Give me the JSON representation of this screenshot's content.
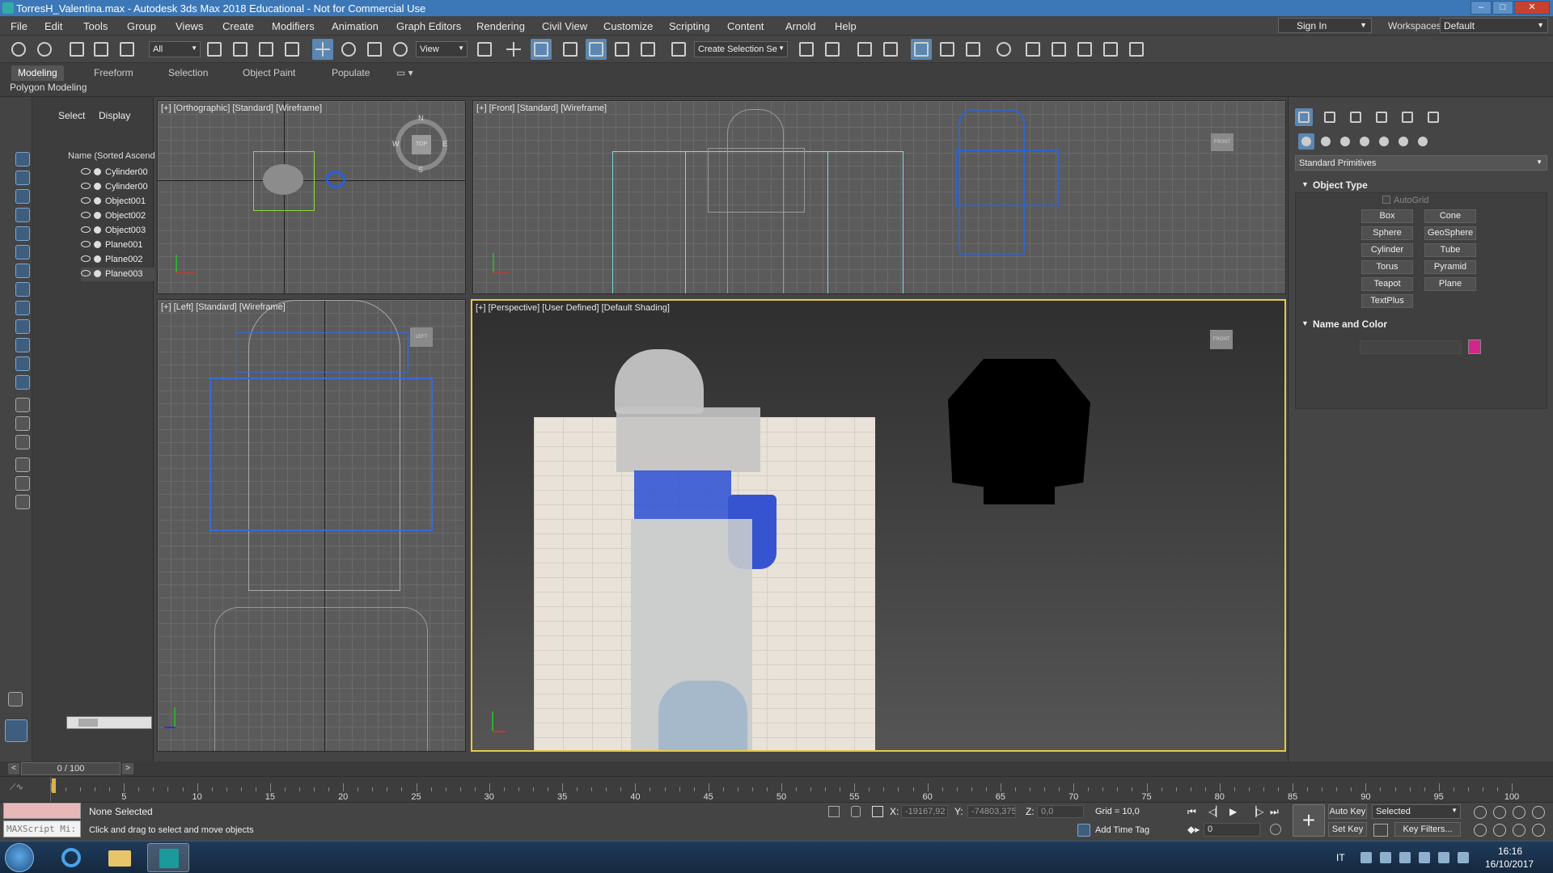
{
  "window": {
    "title": "TorresH_Valentina.max - Autodesk 3ds Max 2018 Educational - Not for Commercial Use"
  },
  "menu": {
    "items": [
      "File",
      "Edit",
      "Tools",
      "Group",
      "Views",
      "Create",
      "Modifiers",
      "Animation",
      "Graph Editors",
      "Rendering",
      "Civil View",
      "Customize",
      "Scripting",
      "Content",
      "Arnold",
      "Help"
    ],
    "sign_in": "Sign In",
    "workspaces_label": "Workspaces:",
    "workspace_value": "Default"
  },
  "toolbar": {
    "filter_value": "All",
    "refcoord_value": "View",
    "named_selection_value": "Create Selection Se"
  },
  "ribbon": {
    "tabs": [
      "Modeling",
      "Freeform",
      "Selection",
      "Object Paint",
      "Populate"
    ],
    "active_tab": "Modeling",
    "sub_label": "Polygon Modeling"
  },
  "explorer": {
    "tabs": [
      "Select",
      "Display"
    ],
    "column_header": "Name (Sorted Ascending)",
    "items": [
      "Cylinder00",
      "Cylinder00",
      "Object001",
      "Object002",
      "Object003",
      "Plane001",
      "Plane002",
      "Plane003"
    ]
  },
  "viewports": {
    "top_left": "[+] [Orthographic] [Standard] [Wireframe]",
    "top_right": "[+] [Front] [Standard] [Wireframe]",
    "bottom_left": "[+] [Left] [Standard] [Wireframe]",
    "bottom_right": "[+] [Perspective] [User Defined] [Default Shading]",
    "viewcube_top": "TOP",
    "viewcube_front": "FRONT",
    "viewcube_left": "LEFT",
    "compass": {
      "n": "N",
      "s": "S",
      "e": "E",
      "w": "W"
    }
  },
  "command_panel": {
    "category": "Standard Primitives",
    "object_type_title": "Object Type",
    "autogrid": "AutoGrid",
    "primitives": [
      "Box",
      "Cone",
      "Sphere",
      "GeoSphere",
      "Cylinder",
      "Tube",
      "Torus",
      "Pyramid",
      "Teapot",
      "Plane",
      "TextPlus"
    ],
    "name_color_title": "Name and Color",
    "swatch_color": "#d2278a"
  },
  "timeline": {
    "frame_display": "0 / 100",
    "ticks": [
      "5",
      "10",
      "15",
      "20",
      "25",
      "30",
      "35",
      "40",
      "45",
      "50",
      "55",
      "60",
      "65",
      "70",
      "75",
      "80",
      "85",
      "90",
      "95",
      "100"
    ]
  },
  "status": {
    "listener_placeholder": "MAXScript Mi:",
    "selection": "None Selected",
    "prompt": "Click and drag to select and move objects",
    "x_label": "X:",
    "x_value": "-19167,92",
    "y_label": "Y:",
    "y_value": "-74803,375",
    "z_label": "Z:",
    "z_value": "0,0",
    "grid": "Grid = 10,0",
    "add_time_tag": "Add Time Tag",
    "frame_value": "0",
    "auto_key": "Auto Key",
    "set_key": "Set Key",
    "key_mode": "Selected",
    "key_filters": "Key Filters..."
  },
  "taskbar": {
    "language": "IT",
    "time": "16:16",
    "date": "16/10/2017"
  }
}
